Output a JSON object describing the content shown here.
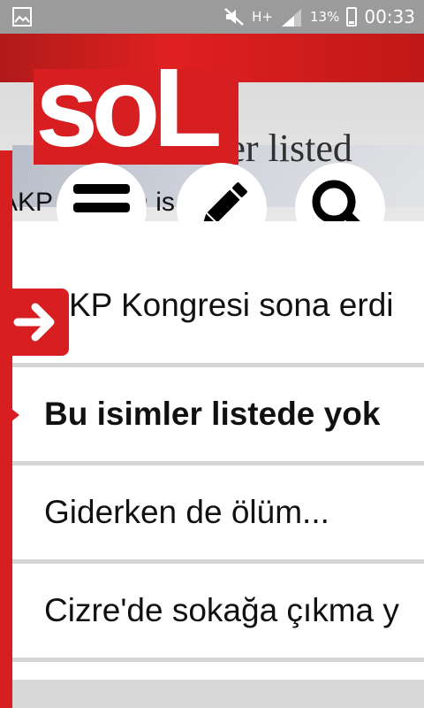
{
  "status_bar": {
    "network": "H+",
    "battery": "13%",
    "time": "00:33",
    "icons": [
      "image-icon",
      "mute-icon",
      "signal-icon",
      "battery-icon"
    ]
  },
  "header": {
    "logo": "soL",
    "background_headline": "Bu isimler listed",
    "background_subheadline": "AKP   ne   ire   n is",
    "buttons": {
      "menu": "menu-icon",
      "edit": "pencil-icon",
      "search": "search-icon"
    }
  },
  "news_list": {
    "items": [
      {
        "label": "KP Kongresi sona erdi"
      },
      {
        "label": "Bu isimler listede yok"
      },
      {
        "label": "Giderken de ölüm..."
      },
      {
        "label": "Cizre'de sokağa çıkma y"
      }
    ]
  },
  "colors": {
    "accent_red": "#d71f22",
    "status_bar": "#9b9b9b",
    "divider": "#d5d5d5"
  }
}
